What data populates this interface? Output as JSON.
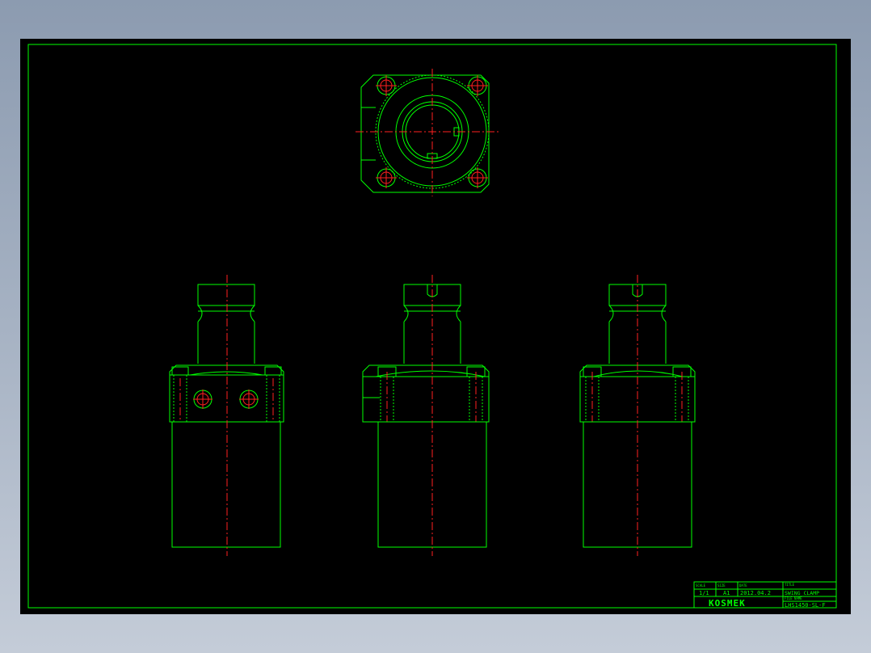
{
  "title_block": {
    "scale_label": "SCALE",
    "scale_value": "1/1",
    "size_label": "SIZE",
    "size_value": "A1",
    "date_label": "DATE",
    "date_value": "2012.04.2",
    "title_label": "TITLE",
    "title_value": "SWING CLAMP",
    "filename_label": "FILE NAME",
    "filename_value": "LHS1450-SL-F",
    "logo_text": "KOSMEK"
  },
  "colors": {
    "background": "#000000",
    "outline": "#00ff00",
    "centerline": "#ff2020"
  }
}
